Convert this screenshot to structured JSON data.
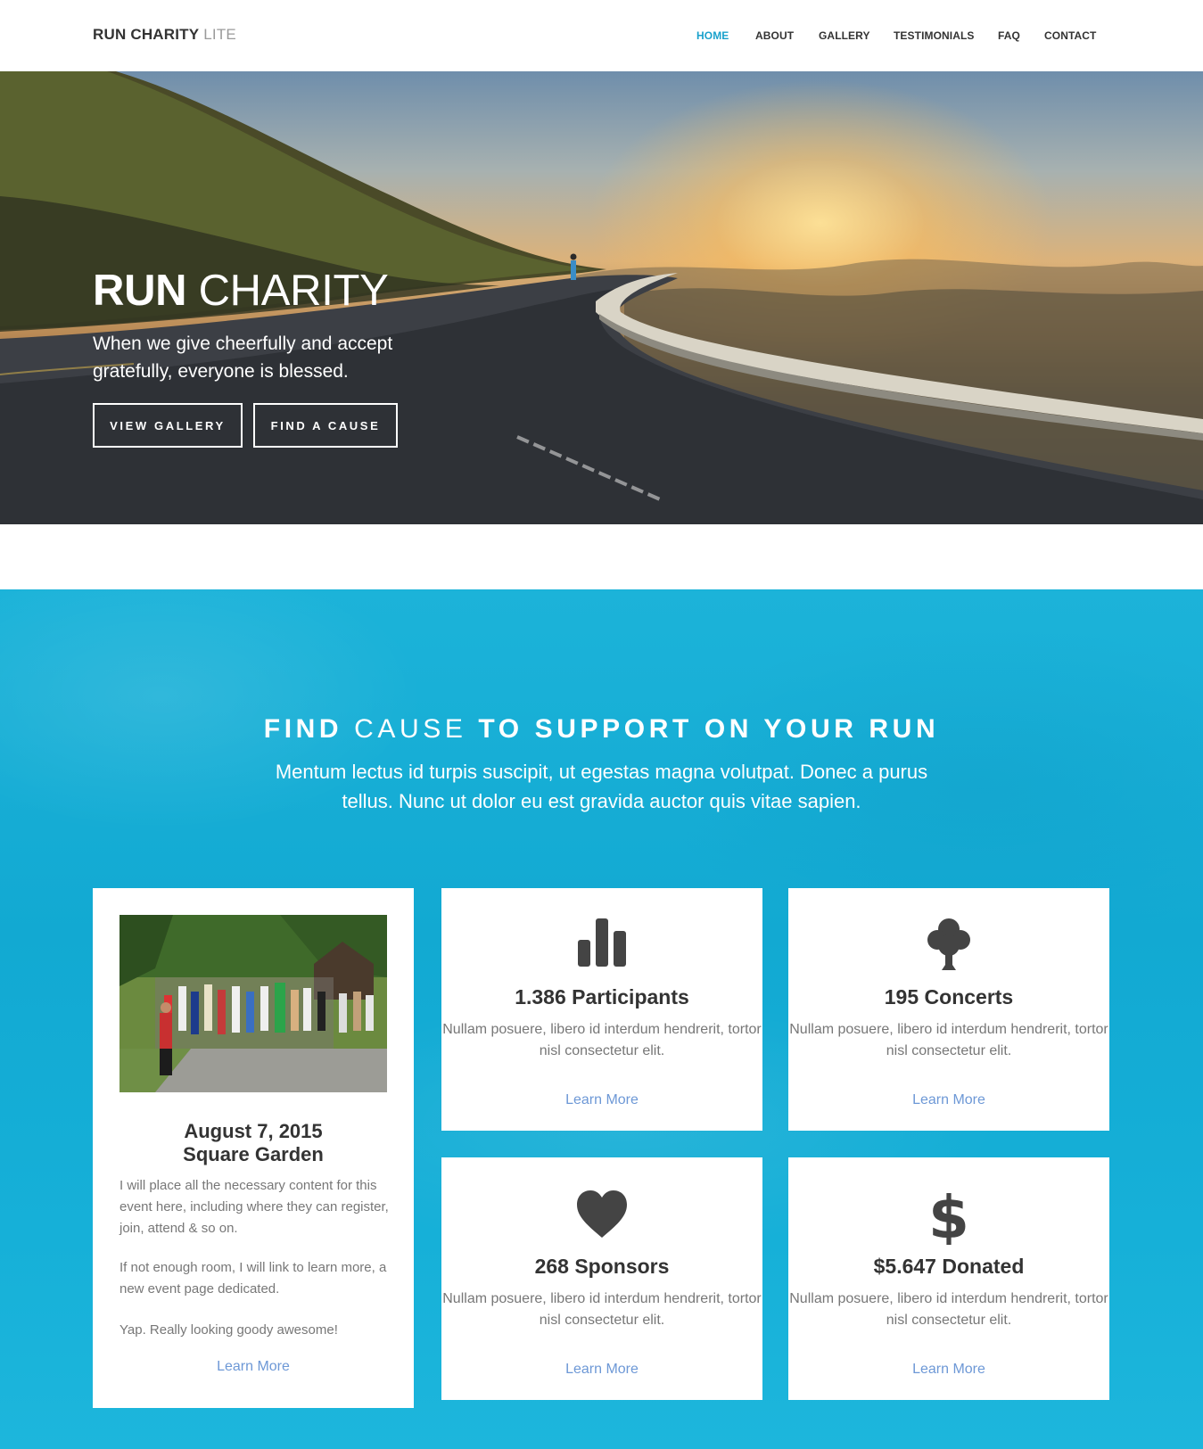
{
  "header": {
    "logo_bold": "RUN CHARITY",
    "logo_light": "LITE",
    "nav": [
      {
        "label": "HOME",
        "active": true
      },
      {
        "label": "ABOUT",
        "active": false
      },
      {
        "label": "GALLERY",
        "active": false
      },
      {
        "label": "TESTIMONIALS",
        "active": false
      },
      {
        "label": "FAQ",
        "active": false
      },
      {
        "label": "CONTACT",
        "active": false
      }
    ]
  },
  "hero": {
    "title_bold": "RUN",
    "title_light": "CHARITY",
    "subtitle": "When we give cheerfully and accept gratefully, everyone is blessed.",
    "buttons": [
      "VIEW GALLERY",
      "FIND A CAUSE"
    ]
  },
  "cause": {
    "title_bold_1": "FIND",
    "title_light": "CAUSE",
    "title_bold_2": "TO SUPPORT ON YOUR RUN",
    "subtitle": "Mentum lectus id turpis suscipit, ut egestas magna volutpat. Donec a purus tellus. Nunc ut dolor eu est gravida auctor quis vitae sapien.",
    "event": {
      "date": "August 7, 2015",
      "place": "Square Garden",
      "paragraphs": [
        "I will place all the necessary content for this event here, including where they can register, join, attend & so on.",
        "If not enough room, I will link to learn more, a new event page dedicated.",
        "Yap. Really looking goody awesome!"
      ],
      "link": "Learn More"
    },
    "stats": [
      {
        "icon": "bar-chart-icon",
        "title": "1.386 Participants",
        "desc": "Nullam posuere, libero id interdum hendrerit, tortor nisl consectetur elit.",
        "link": "Learn More"
      },
      {
        "icon": "tree-icon",
        "title": "195 Concerts",
        "desc": "Nullam posuere, libero id interdum hendrerit, tortor nisl consectetur elit.",
        "link": "Learn More"
      },
      {
        "icon": "heart-icon",
        "title": "268 Sponsors",
        "desc": "Nullam posuere, libero id interdum hendrerit, tortor nisl consectetur elit.",
        "link": "Learn More"
      },
      {
        "icon": "dollar-icon",
        "title": "$5.647 Donated",
        "desc": "Nullam posuere, libero id interdum hendrerit, tortor nisl consectetur elit.",
        "link": "Learn More"
      }
    ]
  },
  "colors": {
    "accent": "#1aa1cc",
    "section_bg": "#15acd4",
    "link": "#6d98d6",
    "text_dark": "#333333",
    "text_muted": "#777777"
  }
}
